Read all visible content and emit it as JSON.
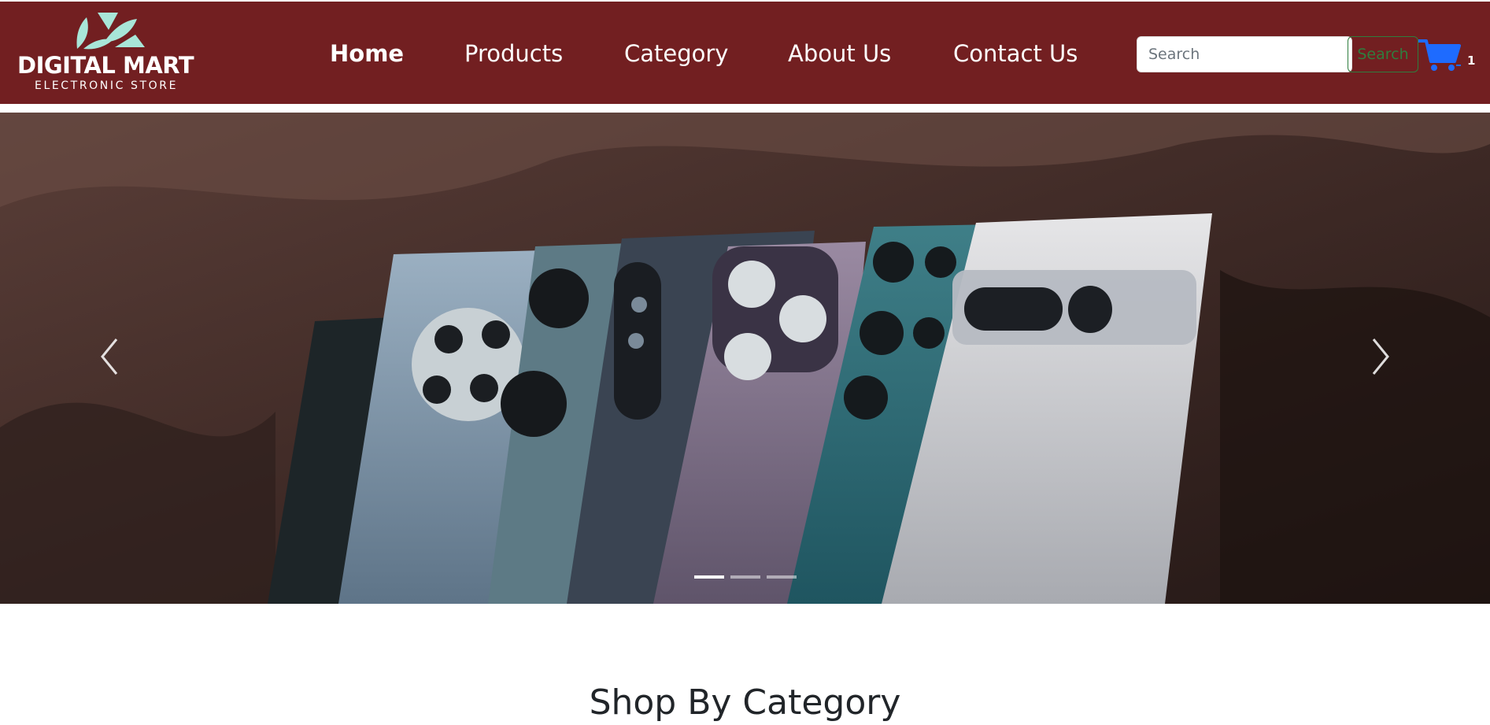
{
  "colors": {
    "navbar_bg": "#721f21",
    "logo_accent": "#a8e6d8",
    "search_button_accent": "#2f7d3e",
    "cart_icon": "#1e6bff"
  },
  "brand": {
    "name": "DIGITAL MART",
    "tagline": "ELECTRONIC STORE"
  },
  "nav": {
    "items": [
      {
        "label": "Home",
        "active": true
      },
      {
        "label": "Products",
        "active": false
      },
      {
        "label": "Category",
        "active": false
      },
      {
        "label": "About Us",
        "active": false
      },
      {
        "label": "Contact Us",
        "active": false
      }
    ]
  },
  "search": {
    "placeholder": "Search",
    "value": "",
    "button_label": "Search"
  },
  "cart": {
    "icon": "shopping-cart-icon",
    "count": "1"
  },
  "carousel": {
    "slide_count": 3,
    "active_index": 0,
    "prev_icon": "chevron-left-icon",
    "next_icon": "chevron-right-icon",
    "slide_image": "row of smartphone backs on leather"
  },
  "sections": {
    "category_title": "Shop By Category"
  }
}
